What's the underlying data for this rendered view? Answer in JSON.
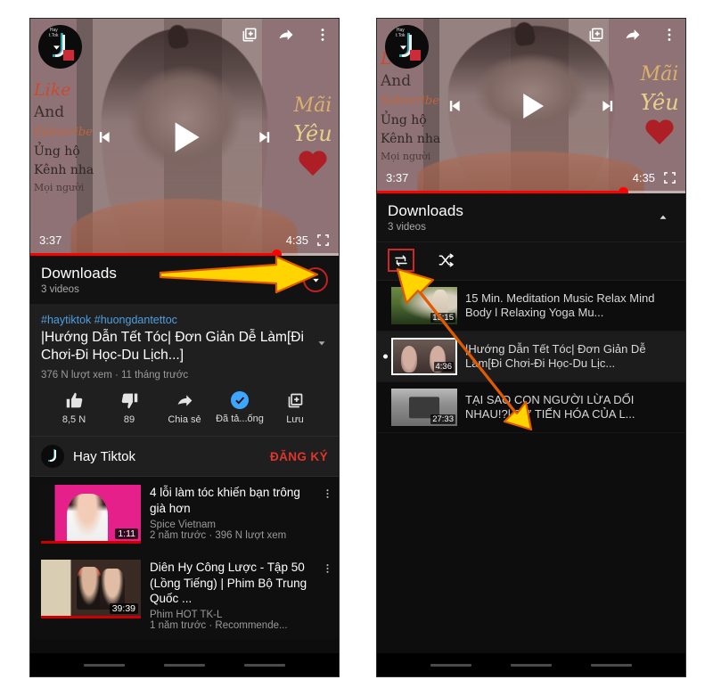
{
  "left_phone": {
    "player": {
      "current_time": "3:37",
      "duration": "4:35",
      "progress_percent": 80,
      "stickers_left": [
        "Like",
        "And",
        "Subscribe",
        "Ủng hộ",
        "Kênh nha",
        "Mọi người"
      ],
      "stickers_right": [
        "Mãi",
        "Yêu"
      ],
      "icons": {
        "add_to_queue": "add-to-queue-icon",
        "share": "share-icon",
        "more": "more-vertical-icon",
        "previous": "previous-icon",
        "play": "play-icon",
        "next": "next-icon",
        "fullscreen": "fullscreen-icon",
        "collapse": "chevron-down-icon"
      }
    },
    "playlist_header": {
      "title": "Downloads",
      "subtitle": "3 videos",
      "toggle_icon": "chevron-down-icon"
    },
    "detail": {
      "hashtags": "#haytiktok #huongdantettoc",
      "title": "|Hướng Dẫn Tết Tóc| Đơn Giản Dễ Làm[Đi Chơi-Đi Học-Du Lịch...]",
      "meta": "376 N lượt xem · 11 tháng trước",
      "expand_icon": "chevron-down-icon"
    },
    "actions": [
      {
        "icon": "thumbs-up-icon",
        "label": "8,5 N"
      },
      {
        "icon": "thumbs-down-icon",
        "label": "89"
      },
      {
        "icon": "share-icon",
        "label": "Chia sẻ"
      },
      {
        "icon": "downloaded-check-icon",
        "label": "Đã tả...ống"
      },
      {
        "icon": "save-to-playlist-icon",
        "label": "Lưu"
      }
    ],
    "channel": {
      "name": "Hay Tiktok",
      "subscribe_label": "ĐĂNG KÝ",
      "subscribe_color": "#e0352b"
    },
    "suggested": [
      {
        "title": "4 lỗi làm tóc khiến bạn trông già hơn",
        "channel": "Spice Vietnam",
        "meta": "2 năm trước · 396 N lượt xem",
        "duration": "1:11",
        "more_icon": "more-vertical-icon"
      },
      {
        "title": "Diên Hy Công Lược - Tập 50 (Lồng Tiếng) | Phim Bộ Trung Quốc ...",
        "channel": "Phim HOT TK-L",
        "meta": "1 năm trước · Recommende...",
        "duration": "39:39",
        "more_icon": "more-vertical-icon"
      }
    ]
  },
  "right_phone": {
    "player": {
      "current_time": "3:37",
      "duration": "4:35",
      "progress_percent": 80,
      "stickers_left": [
        "Like",
        "And",
        "Subscribe",
        "Ủng hộ",
        "Kênh nha",
        "Mọi người"
      ],
      "stickers_right": [
        "Mãi",
        "Yêu"
      ],
      "icons": {
        "add_to_queue": "add-to-queue-icon",
        "share": "share-icon",
        "more": "more-vertical-icon",
        "previous": "previous-icon",
        "play": "play-icon",
        "next": "next-icon",
        "fullscreen": "fullscreen-icon",
        "collapse": "chevron-down-icon"
      }
    },
    "playlist_header": {
      "title": "Downloads",
      "subtitle": "3 videos",
      "toggle_icon": "chevron-up-icon"
    },
    "playlist_controls": {
      "loop_icon": "loop-icon",
      "shuffle_icon": "shuffle-icon",
      "highlight_color": "#d12626"
    },
    "playlist_items": [
      {
        "title": "15 Min. Meditation Music Relax Mind Body l Relaxing Yoga Mu...",
        "duration": "15:15",
        "active": false
      },
      {
        "title": "|Hướng Dẫn Tết Tóc| Đơn Giản Dễ Làm[Đi Chơi-Đi Học-Du Lịc...",
        "duration": "4:36",
        "active": true
      },
      {
        "title": "TẠI SAO CON NGƯỜI LỪA DỐI NHAU!?| SỰ TIẾN HÓA CỦA L...",
        "duration": "27:33",
        "active": false
      }
    ]
  },
  "annotations": {
    "arrow_color": "#ffd400",
    "arrow_outline": "#e05a00",
    "left_arrow_target": "playlist-collapse-toggle",
    "right_arrow_target": "loop-button"
  }
}
